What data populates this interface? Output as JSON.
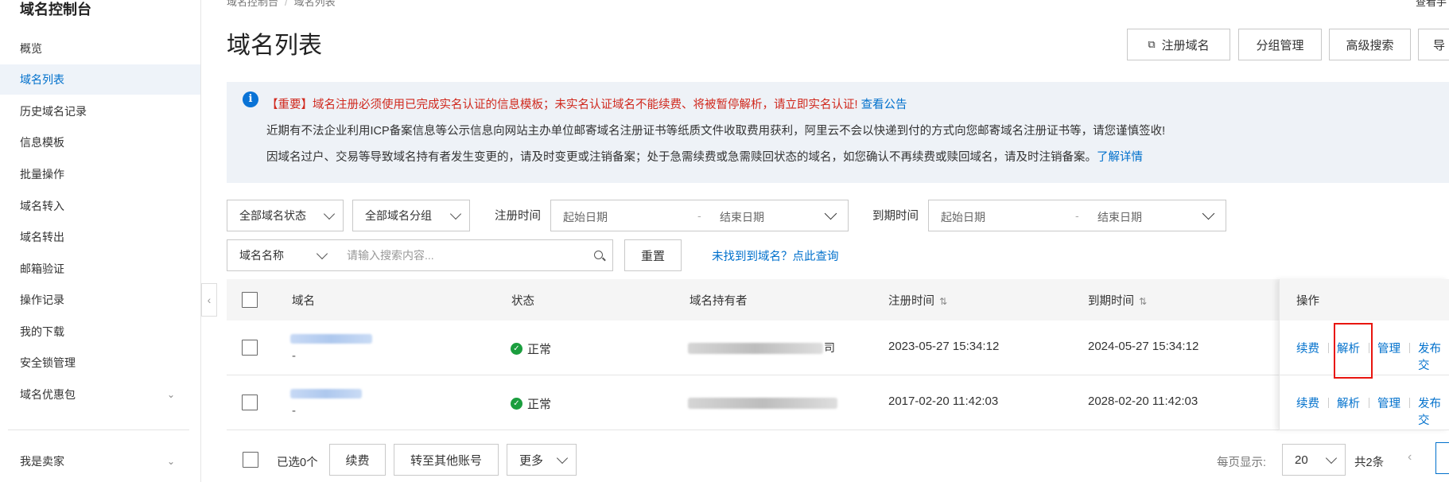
{
  "sidebar": {
    "title": "域名控制台",
    "items": [
      {
        "label": "概览",
        "active": false
      },
      {
        "label": "域名列表",
        "active": true
      },
      {
        "label": "历史域名记录",
        "active": false
      },
      {
        "label": "信息模板",
        "active": false
      },
      {
        "label": "批量操作",
        "active": false
      },
      {
        "label": "域名转入",
        "active": false
      },
      {
        "label": "域名转出",
        "active": false
      },
      {
        "label": "邮箱验证",
        "active": false
      },
      {
        "label": "操作记录",
        "active": false
      },
      {
        "label": "我的下载",
        "active": false
      },
      {
        "label": "安全锁管理",
        "active": false
      },
      {
        "label": "域名优惠包",
        "active": false,
        "expandable": true
      }
    ],
    "footer_item": {
      "label": "我是卖家",
      "expandable": true
    }
  },
  "breadcrumb": [
    "域名控制台",
    "域名列表"
  ],
  "top_right_link": "查看手",
  "page_title": "域名列表",
  "header_buttons": {
    "register": "注册域名",
    "group_manage": "分组管理",
    "advanced_search": "高级搜索",
    "export": "导"
  },
  "notice": {
    "line1_red": "【重要】域名注册必须使用已完成实名认证的信息模板；未实名认证域名不能续费、将被暂停解析，请立即实名认证!",
    "line1_link": "查看公告",
    "line2": "近期有不法企业利用ICP备案信息等公示信息向网站主办单位邮寄域名注册证书等纸质文件收取费用获利，阿里云不会以快递到付的方式向您邮寄域名注册证书等，请您谨慎签收!",
    "line3": "因域名过户、交易等导致域名持有者发生变更的，请及时变更或注销备案；处于急需续费或急需赎回状态的域名，如您确认不再续费或赎回域名，请及时注销备案。",
    "line3_link": "了解详情"
  },
  "filters": {
    "status_select": "全部域名状态",
    "group_select": "全部域名分组",
    "reg_time_label": "注册时间",
    "exp_time_label": "到期时间",
    "start_date_placeholder": "起始日期",
    "end_date_placeholder": "结束日期",
    "search_field_select": "域名名称",
    "search_placeholder": "请输入搜索内容...",
    "reset_button": "重置",
    "not_found_link": "未找到到域名？点此查询"
  },
  "table": {
    "headers": {
      "domain": "域名",
      "status": "状态",
      "holder": "域名持有者",
      "reg_time": "注册时间",
      "exp_time": "到期时间",
      "ops": "操作"
    },
    "rows": [
      {
        "domain_sub": "-",
        "status": "正常",
        "holder_tail": "司",
        "reg_time": "2023-05-27 15:34:12",
        "exp_time": "2024-05-27 15:34:12"
      },
      {
        "domain_sub": "-",
        "status": "正常",
        "holder_tail": "",
        "reg_time": "2017-02-20 11:42:03",
        "exp_time": "2028-02-20 11:42:03"
      }
    ],
    "ops": {
      "renew": "续费",
      "resolve": "解析",
      "manage": "管理",
      "publish": "发布交"
    }
  },
  "footer": {
    "selected": "已选0个",
    "renew": "续费",
    "transfer": "转至其他账号",
    "more": "更多",
    "per_page_label": "每页显示:",
    "per_page_value": "20",
    "total": "共2条"
  },
  "colors": {
    "accent": "#0070cc",
    "notice_red": "#d0281d",
    "highlight_box": "#e8150f",
    "success": "#1b9e3e"
  }
}
